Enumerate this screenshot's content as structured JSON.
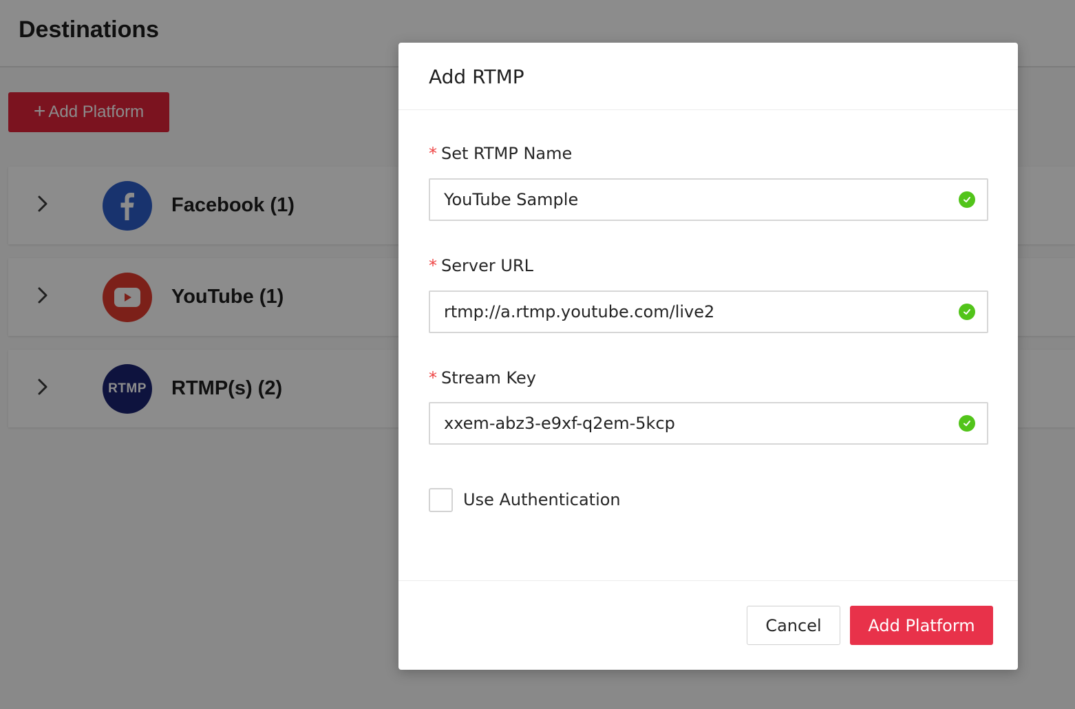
{
  "page": {
    "title": "Destinations",
    "add_button_icon": "plus-icon",
    "add_button_label": "Add Platform",
    "accent_color": "#e0243a"
  },
  "platforms": [
    {
      "label": "Facebook (1)",
      "icon": "facebook-icon",
      "color": "#2d5ec9"
    },
    {
      "label": "YouTube (1)",
      "icon": "youtube-icon",
      "color": "#e23b2e"
    },
    {
      "label": "RTMP(s) (2)",
      "icon": "rtmp-icon",
      "logo_text": "RTMP",
      "color": "#1a2372"
    }
  ],
  "modal": {
    "title": "Add RTMP",
    "fields": [
      {
        "label": "Set RTMP Name",
        "required_mark": "*",
        "value": "YouTube Sample",
        "status": "valid"
      },
      {
        "label": "Server URL",
        "required_mark": "*",
        "value": "rtmp://a.rtmp.youtube.com/live2",
        "status": "valid"
      },
      {
        "label": "Stream Key",
        "required_mark": "*",
        "value": "xxem-abz3-e9xf-q2em-5kcp",
        "status": "valid"
      }
    ],
    "use_auth_label": "Use Authentication",
    "use_auth_checked": false,
    "cancel_label": "Cancel",
    "submit_label": "Add Platform",
    "valid_color": "#52c41a",
    "primary_color": "#e8324a"
  }
}
